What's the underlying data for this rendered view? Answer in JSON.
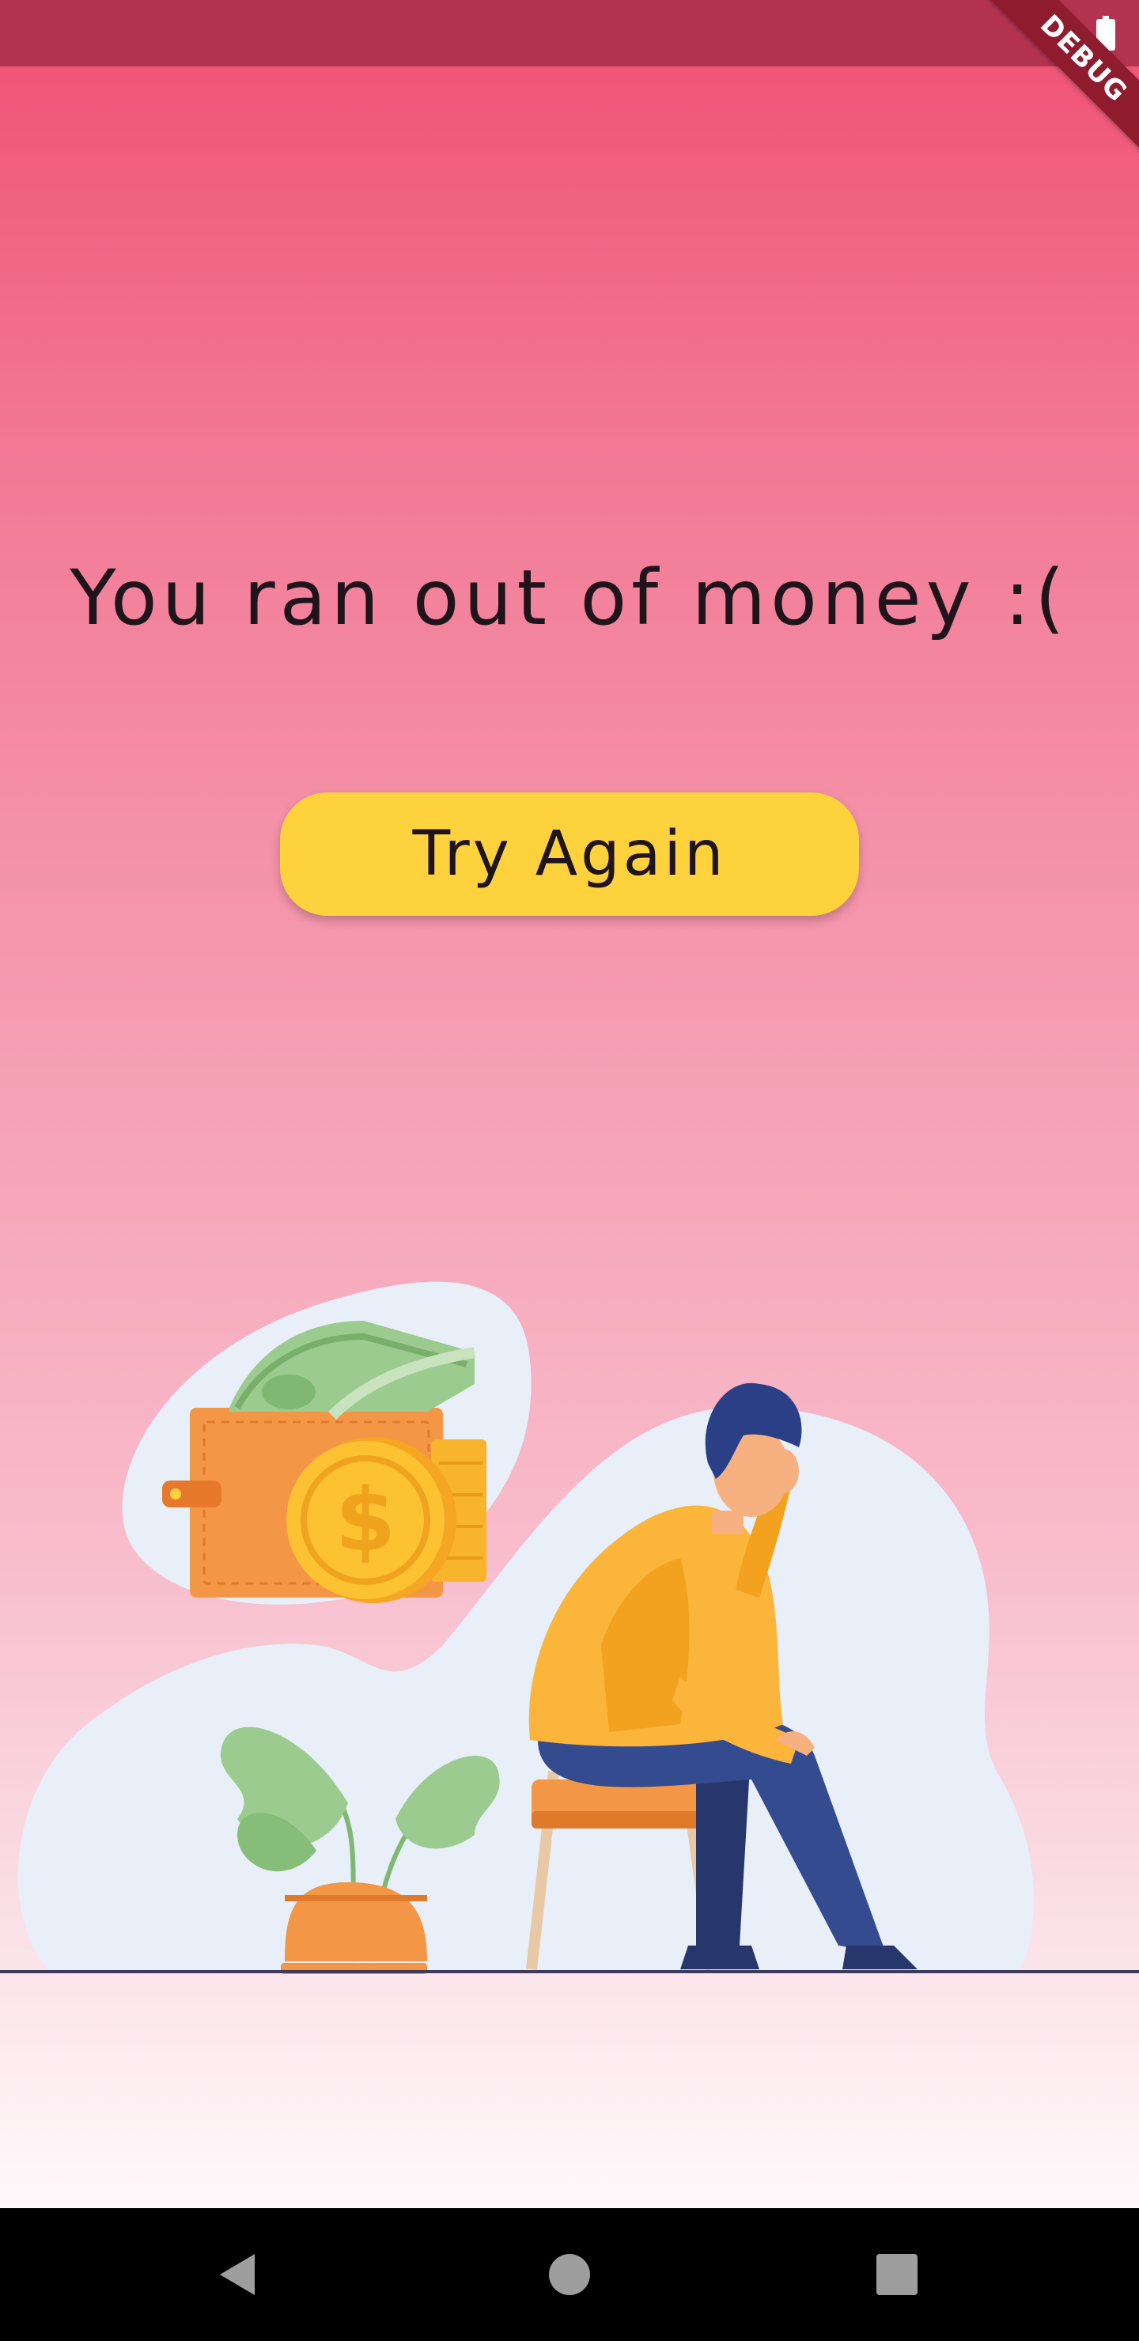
{
  "status_bar": {
    "battery_icon": "battery-full-icon",
    "debug_label": "DEBUG",
    "color": "#b23451"
  },
  "main": {
    "message": "You ran out of money :(",
    "try_again_label": "Try Again",
    "button_color": "#fed23c"
  },
  "illustration": {
    "elements": [
      "wallet-icon",
      "cash-icon",
      "coin-icon",
      "plant-icon",
      "sad-man-icon",
      "stool-icon"
    ]
  },
  "nav_bar": {
    "back_icon": "back-triangle-icon",
    "home_icon": "home-circle-icon",
    "recents_icon": "recents-square-icon"
  }
}
